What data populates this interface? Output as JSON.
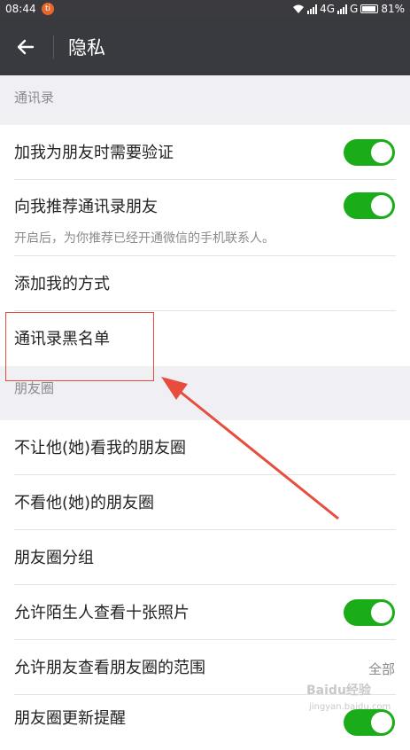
{
  "status_bar": {
    "time": "08:44",
    "app_icon": "mi-icon",
    "network": "4G",
    "network2": "G",
    "battery": "81%"
  },
  "app_bar": {
    "title": "隐私",
    "back_icon": "back-arrow-icon"
  },
  "sections": {
    "contacts": {
      "header": "通讯录",
      "items": {
        "verify": {
          "label": "加我为朋友时需要验证",
          "toggle": true
        },
        "recommend": {
          "label": "向我推荐通讯录朋友",
          "hint": "开启后，为你推荐已经开通微信的手机联系人。",
          "toggle": true
        },
        "add_methods": {
          "label": "添加我的方式"
        },
        "blacklist": {
          "label": "通讯录黑名单"
        }
      }
    },
    "moments": {
      "header": "朋友圈",
      "items": {
        "hide_from": {
          "label": "不让他(她)看我的朋友圈"
        },
        "dont_see": {
          "label": "不看他(她)的朋友圈"
        },
        "groups": {
          "label": "朋友圈分组"
        },
        "strangers": {
          "label": "允许陌生人查看十张照片",
          "toggle": true
        },
        "range": {
          "label": "允许朋友查看朋友圈的范围",
          "value": "全部"
        },
        "updates": {
          "label": "朋友圈更新提醒",
          "toggle": true
        }
      }
    }
  },
  "watermark": {
    "brand": "Baidu经验",
    "url": "jingyan.baidu.com"
  },
  "colors": {
    "accent": "#1aad19",
    "app_bar": "#393a3f",
    "annotation": "#e74c3c"
  }
}
